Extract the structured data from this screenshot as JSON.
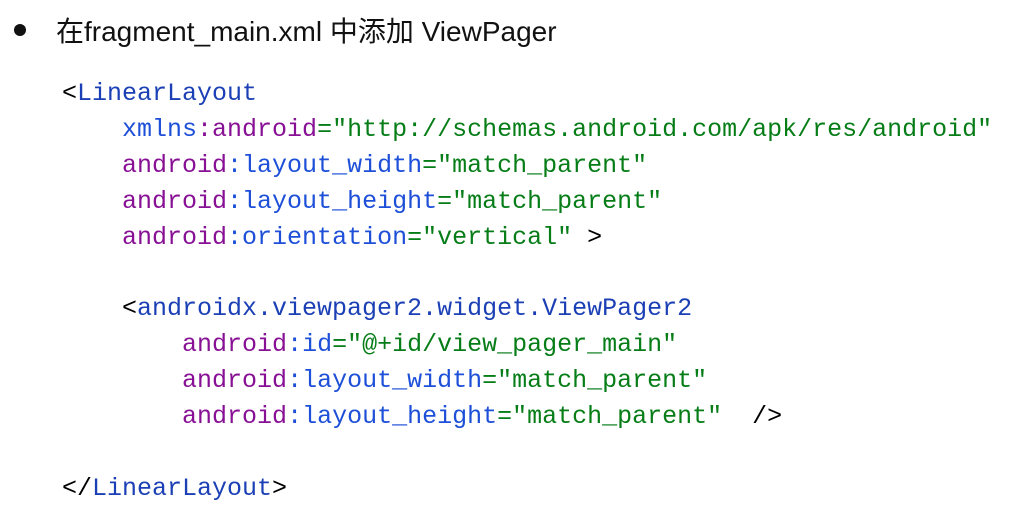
{
  "heading": {
    "text": "在fragment_main.xml 中添加 ViewPager"
  },
  "code_lines": [
    [
      [
        "pun",
        "<"
      ],
      [
        "tag",
        "LinearLayout"
      ]
    ],
    [
      [
        "pun",
        "    "
      ],
      [
        "attr",
        "xmlns"
      ],
      [
        "ns",
        ":android"
      ],
      [
        "str",
        "=\"http://schemas.android.com/apk/res/android\""
      ]
    ],
    [
      [
        "pun",
        "    "
      ],
      [
        "ns",
        "android"
      ],
      [
        "attr",
        ":layout_width"
      ],
      [
        "str",
        "=\"match_parent\""
      ]
    ],
    [
      [
        "pun",
        "    "
      ],
      [
        "ns",
        "android"
      ],
      [
        "attr",
        ":layout_height"
      ],
      [
        "str",
        "=\"match_parent\""
      ]
    ],
    [
      [
        "pun",
        "    "
      ],
      [
        "ns",
        "android"
      ],
      [
        "attr",
        ":orientation"
      ],
      [
        "str",
        "=\"vertical\""
      ],
      [
        "pun",
        " >"
      ]
    ],
    [],
    [
      [
        "pun",
        "    <"
      ],
      [
        "tag",
        "androidx.viewpager2.widget.ViewPager2"
      ]
    ],
    [
      [
        "pun",
        "        "
      ],
      [
        "ns",
        "android"
      ],
      [
        "attr",
        ":id"
      ],
      [
        "str",
        "=\"@+id/view_pager_main\""
      ]
    ],
    [
      [
        "pun",
        "        "
      ],
      [
        "ns",
        "android"
      ],
      [
        "attr",
        ":layout_width"
      ],
      [
        "str",
        "=\"match_parent\""
      ]
    ],
    [
      [
        "pun",
        "        "
      ],
      [
        "ns",
        "android"
      ],
      [
        "attr",
        ":layout_height"
      ],
      [
        "str",
        "=\"match_parent\""
      ],
      [
        "pun",
        "  />"
      ]
    ],
    [],
    [
      [
        "pun",
        "</"
      ],
      [
        "tag",
        "LinearLayout"
      ],
      [
        "pun",
        ">"
      ]
    ]
  ]
}
